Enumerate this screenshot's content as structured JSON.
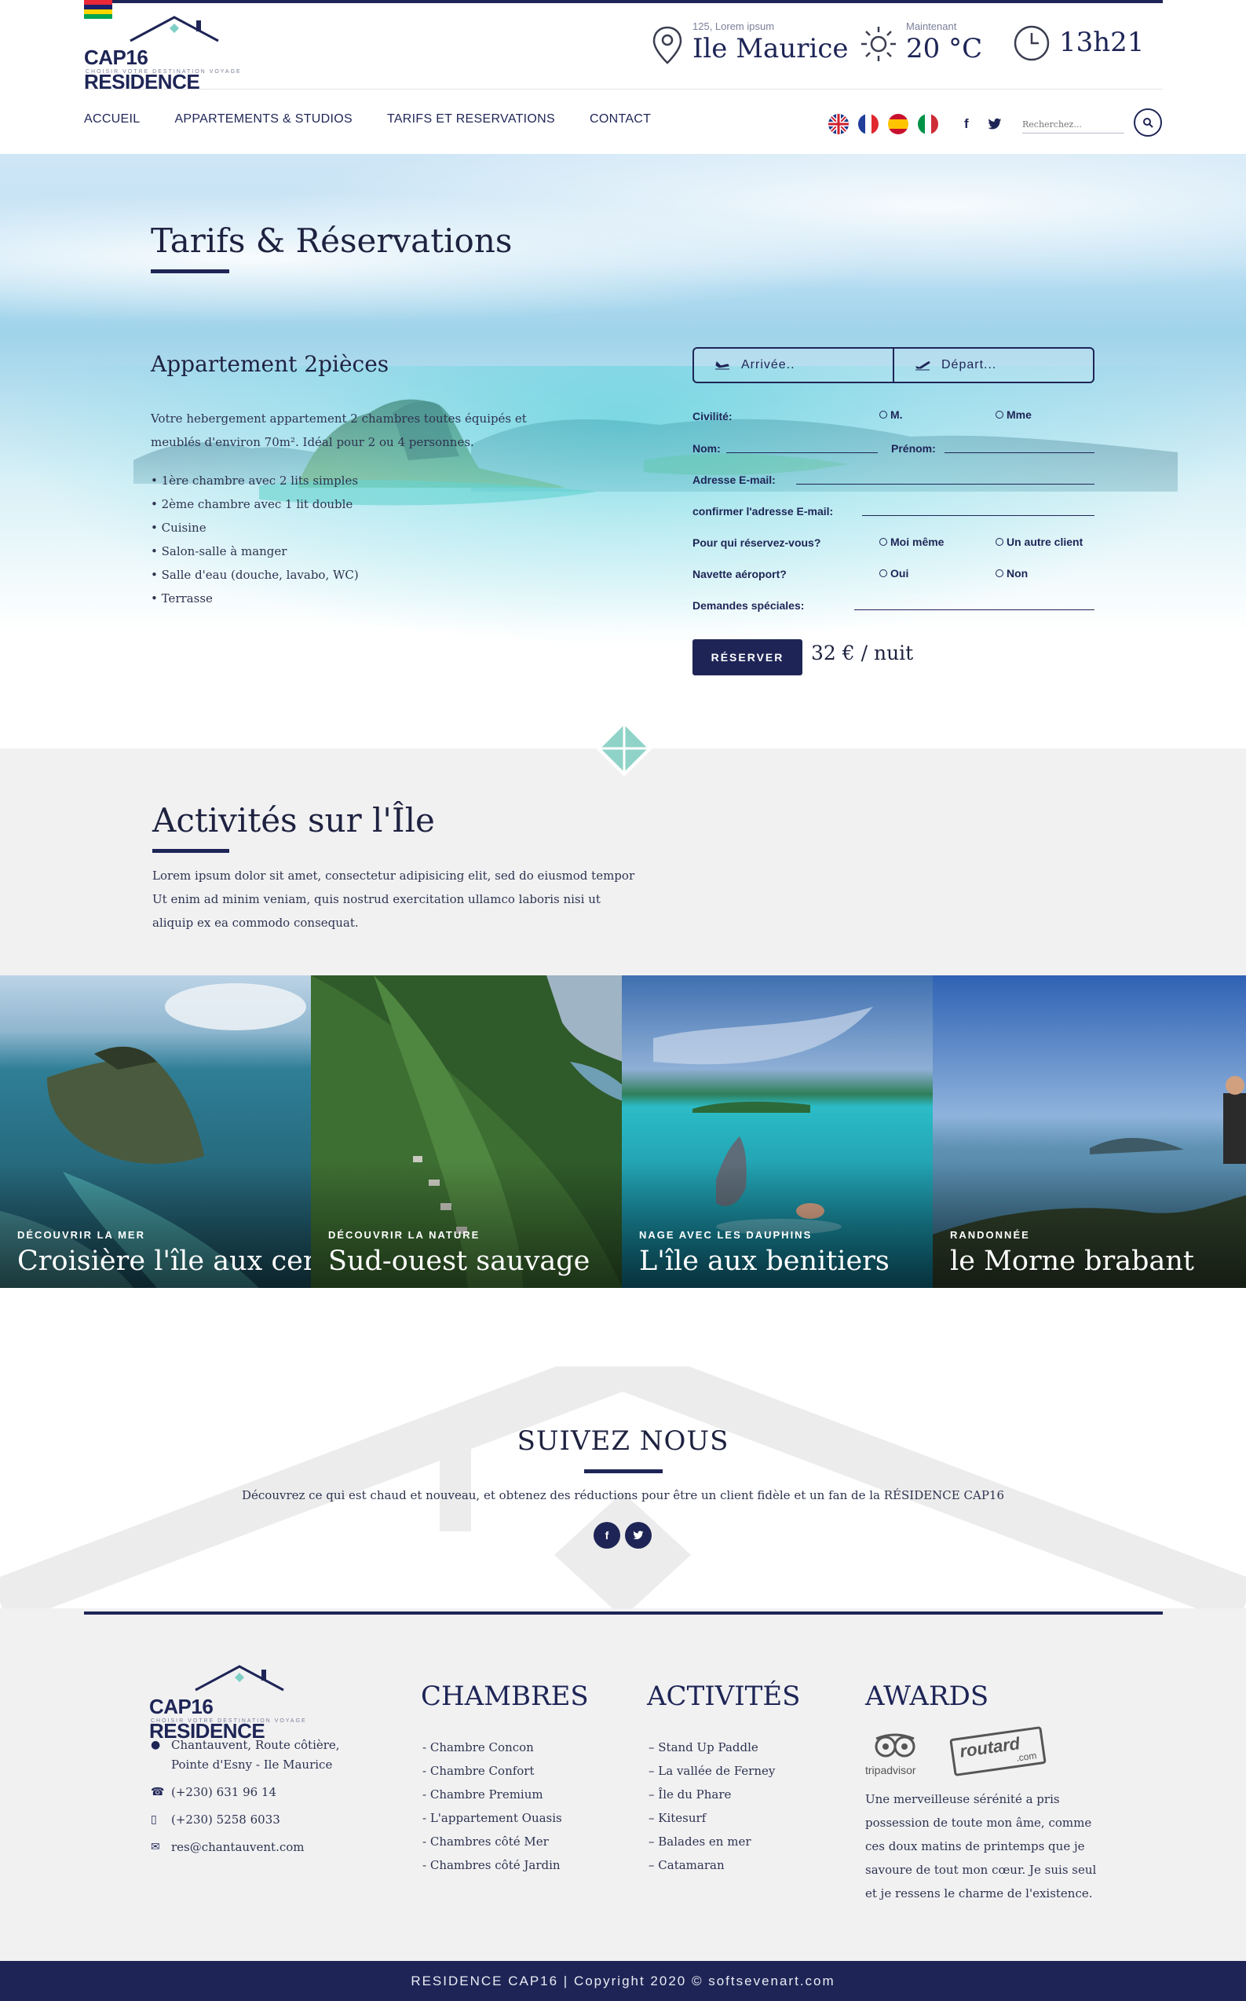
{
  "brand": {
    "name": "CAP16 RESIDENCE",
    "tagline": "CHOISIR VOTRE DESTINATION VOYAGE"
  },
  "header": {
    "location_small": "125, Lorem ipsum",
    "location": "Ile Maurice",
    "weather_small": "Maintenant",
    "temperature": "20 °C",
    "time": "13h21"
  },
  "nav": {
    "items": [
      "ACCUEIL",
      "APPARTEMENTS & STUDIOS",
      "TARIFS ET RESERVATIONS",
      "CONTACT"
    ]
  },
  "languages": [
    "English",
    "Français",
    "Español",
    "Italiano"
  ],
  "search": {
    "placeholder": "Recherchez..."
  },
  "hero": {
    "title": "Tarifs & Réservations",
    "apt_title": "Appartement 2pièces",
    "apt_desc": "Votre hebergement appartement 2 chambres toutes équipés et meublés d'environ 70m². Idéal pour 2 ou 4 personnes.",
    "features": [
      "• 1ère chambre avec 2 lits simples",
      "• 2ème chambre avec 1 lit double",
      "• Cuisine",
      "• Salon-salle à manger",
      "• Salle d'eau (douche, lavabo, WC)",
      "• Terrasse"
    ]
  },
  "form": {
    "arrival": "Arrivée..",
    "departure": "Départ...",
    "civility_label": "Civilité:",
    "civility_m": "M.",
    "civility_mme": "Mme",
    "name_label": "Nom:",
    "firstname_label": "Prénom:",
    "email_label": "Adresse E-mail:",
    "email_confirm_label": "confirmer l'adresse E-mail:",
    "for_whom_label": "Pour qui réservez-vous?",
    "for_me": "Moi même",
    "for_other": "Un autre client",
    "shuttle_label": "Navette aéroport?",
    "yes": "Oui",
    "no": "Non",
    "requests_label": "Demandes spéciales:",
    "reserve_button": "RÉSERVER",
    "price": "32 € / nuit"
  },
  "activities": {
    "title": "Activités sur l'Île",
    "desc": "Lorem ipsum dolor sit amet, consectetur adipisicing elit, sed do eiusmod tempor Ut enim ad minim veniam, quis nostrud exercitation ullamco laboris nisi ut aliquip ex ea commodo consequat.",
    "tiles": [
      {
        "kicker": "DÉCOUVRIR LA MER",
        "title": "Croisière l'île aux cerfs"
      },
      {
        "kicker": "DÉCOUVRIR LA NATURE",
        "title": "Sud-ouest sauvage"
      },
      {
        "kicker": "NAGE AVEC LES DAUPHINS",
        "title": "L'île aux benitiers"
      },
      {
        "kicker": "RANDONNÉE",
        "title": "le Morne brabant"
      }
    ]
  },
  "follow": {
    "title": "SUIVEZ NOUS",
    "text": "Découvrez ce qui est chaud et nouveau, et obtenez des réductions pour être un client fidèle et un fan de la RÉSIDENCE CAP16"
  },
  "footer": {
    "address_line1": "Chantauvent, Route côtière,",
    "address_line2": "Pointe d'Esny - Ile Maurice",
    "phone": "(+230) 631 96 14",
    "mobile": "(+230) 5258 6033",
    "email": "res@chantauvent.com",
    "chambres_title": "CHAMBRES",
    "chambres": [
      "- Chambre Concon",
      "- Chambre Confort",
      "- Chambre Premium",
      "- L'appartement Ouasis",
      "- Chambres côté Mer",
      "- Chambres côté Jardin"
    ],
    "activites_title": "ACTIVITÉS",
    "activites": [
      "– Stand Up Paddle",
      "– La vallée de Ferney",
      "– Île du Phare",
      "– Kitesurf",
      "– Balades en mer",
      "– Catamaran"
    ],
    "awards_title": "AWARDS",
    "tripadvisor": "tripadvisor",
    "routard": "routard",
    "routard_sub": ".com",
    "awards_text": "Une merveilleuse sérénité a pris possession de toute mon âme, comme ces doux matins de printemps que je savoure de tout mon cœur. Je suis seul et je ressens le charme de l'existence.",
    "copyright": "RESIDENCE CAP16 | Copyright 2020 © softsevenart.com"
  },
  "colors": {
    "navy": "#1e2556",
    "light_gray": "#f1f1f2",
    "teal": "#7fcfc6"
  }
}
